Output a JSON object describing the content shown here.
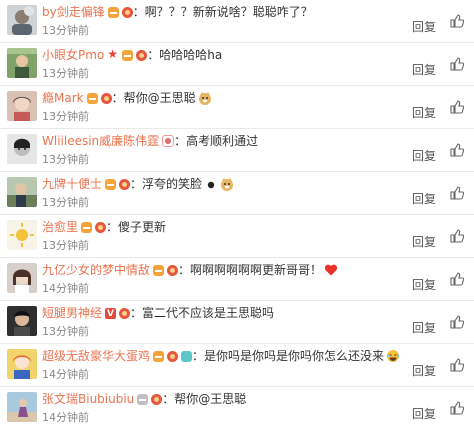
{
  "comments": [
    {
      "username": "by剑走偏锋",
      "text": "：啊？？？新新说啥？聪聪咋了？",
      "time": "13分钟前",
      "reply": "回复"
    },
    {
      "username": "小眼女Pmo",
      "text": "：哈哈哈哈ha",
      "time": "13分钟前",
      "reply": "回复"
    },
    {
      "username": "瘾Mark",
      "text": "：帮你@王思聪",
      "time": "13分钟前",
      "reply": "回复"
    },
    {
      "username": "Wliileesin威廉陈伟霆",
      "text": "：高考顺利通过",
      "time": "13分钟前",
      "reply": "回复"
    },
    {
      "username": "九牌十便士",
      "text": "：浮夸的笑脸",
      "time": "13分钟前",
      "reply": "回复"
    },
    {
      "username": "治愈里",
      "text": "：傻子更新",
      "time": "13分钟前",
      "reply": "回复"
    },
    {
      "username": "九亿少女的梦中情敌",
      "text": "：啊啊啊啊啊啊更新哥哥！",
      "time": "14分钟前",
      "reply": "回复"
    },
    {
      "username": "短腿男神经",
      "text": "：富二代不应该是王思聪吗",
      "time": "13分钟前",
      "reply": "回复"
    },
    {
      "username": "超级无敌豪华大蛋鸡",
      "text": "：是你吗是你吗是你吗你怎么还没来",
      "time": "14分钟前",
      "reply": "回复"
    },
    {
      "username": "张文瑞Biubiubiu",
      "text": "：帮你@王思聪",
      "time": "14分钟前",
      "reply": "回复"
    }
  ]
}
